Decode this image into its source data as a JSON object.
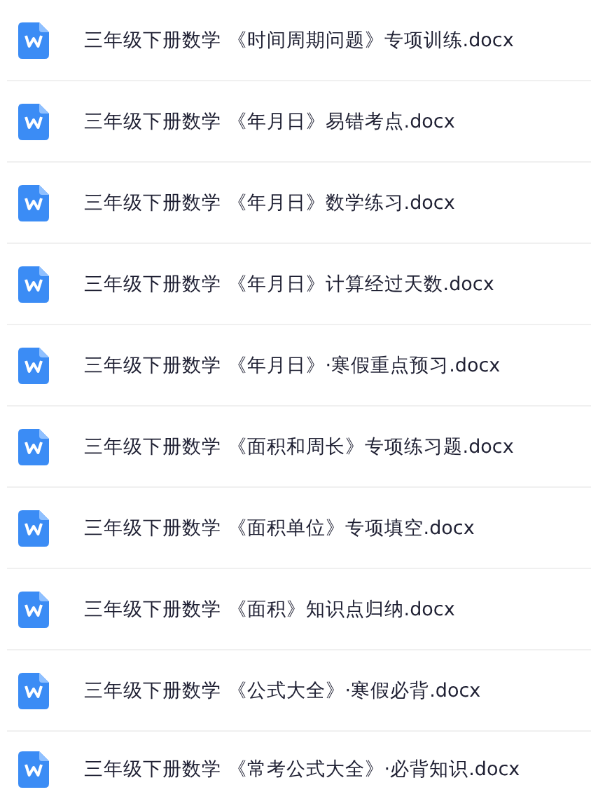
{
  "files": [
    {
      "name": "三年级下册数学 《时间周期问题》专项训练.docx"
    },
    {
      "name": "三年级下册数学 《年月日》易错考点.docx"
    },
    {
      "name": "三年级下册数学 《年月日》数学练习.docx"
    },
    {
      "name": "三年级下册数学 《年月日》计算经过天数.docx"
    },
    {
      "name": "三年级下册数学 《年月日》·寒假重点预习.docx"
    },
    {
      "name": "三年级下册数学 《面积和周长》专项练习题.docx"
    },
    {
      "name": "三年级下册数学 《面积单位》专项填空.docx"
    },
    {
      "name": "三年级下册数学 《面积》知识点归纳.docx"
    },
    {
      "name": "三年级下册数学 《公式大全》·寒假必背.docx"
    },
    {
      "name": "三年级下册数学 《常考公式大全》·必背知识.docx"
    }
  ]
}
